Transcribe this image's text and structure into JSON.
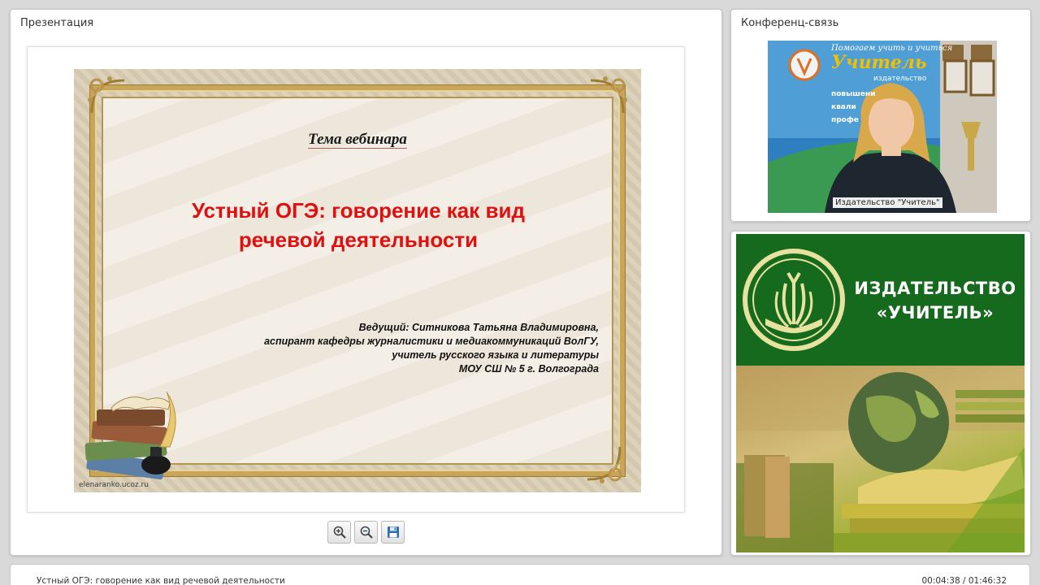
{
  "presentation_panel": {
    "title": "Презентация",
    "slide": {
      "theme": "Тема вебинара",
      "title_line1": "Устный ОГЭ: говорение как вид",
      "title_line2": "речевой деятельности",
      "presenter_line1": "Ведущий:   Ситникова Татьяна Владимировна,",
      "presenter_line2": "аспирант кафедры журналистики и медиакоммуникаций ВолГУ,",
      "presenter_line3": "учитель русского языка и литературы",
      "presenter_line4": "МОУ СШ № 5 г. Волгограда",
      "credit": "elenaranko.ucoz.ru"
    },
    "toolbar": {
      "zoom_in_icon": "zoom-in-icon",
      "zoom_out_icon": "zoom-out-icon",
      "save_icon": "floppy-disk-icon"
    }
  },
  "conference_panel": {
    "title": "Конференц-связь",
    "video_label": "Издательство \"Учитель\"",
    "banner_top": "Помогаем учить и учиться",
    "banner_brand": "Учитель",
    "banner_sub": "издательство",
    "banner_items": [
      "повышени",
      "квали",
      "профе"
    ]
  },
  "logo_panel": {
    "line1": "ИЗДАТЕЛЬСТВО",
    "line2": "«УЧИТЕЛЬ»",
    "colors": {
      "green": "#166a1e"
    }
  },
  "bottom_bar": {
    "title": "Устный ОГЭ: говорение как вид речевой деятельности",
    "time": "00:04:38 / 01:46:32"
  },
  "colors": {
    "slide_title": "#e01010",
    "frame_gold": "#c9a55a"
  }
}
